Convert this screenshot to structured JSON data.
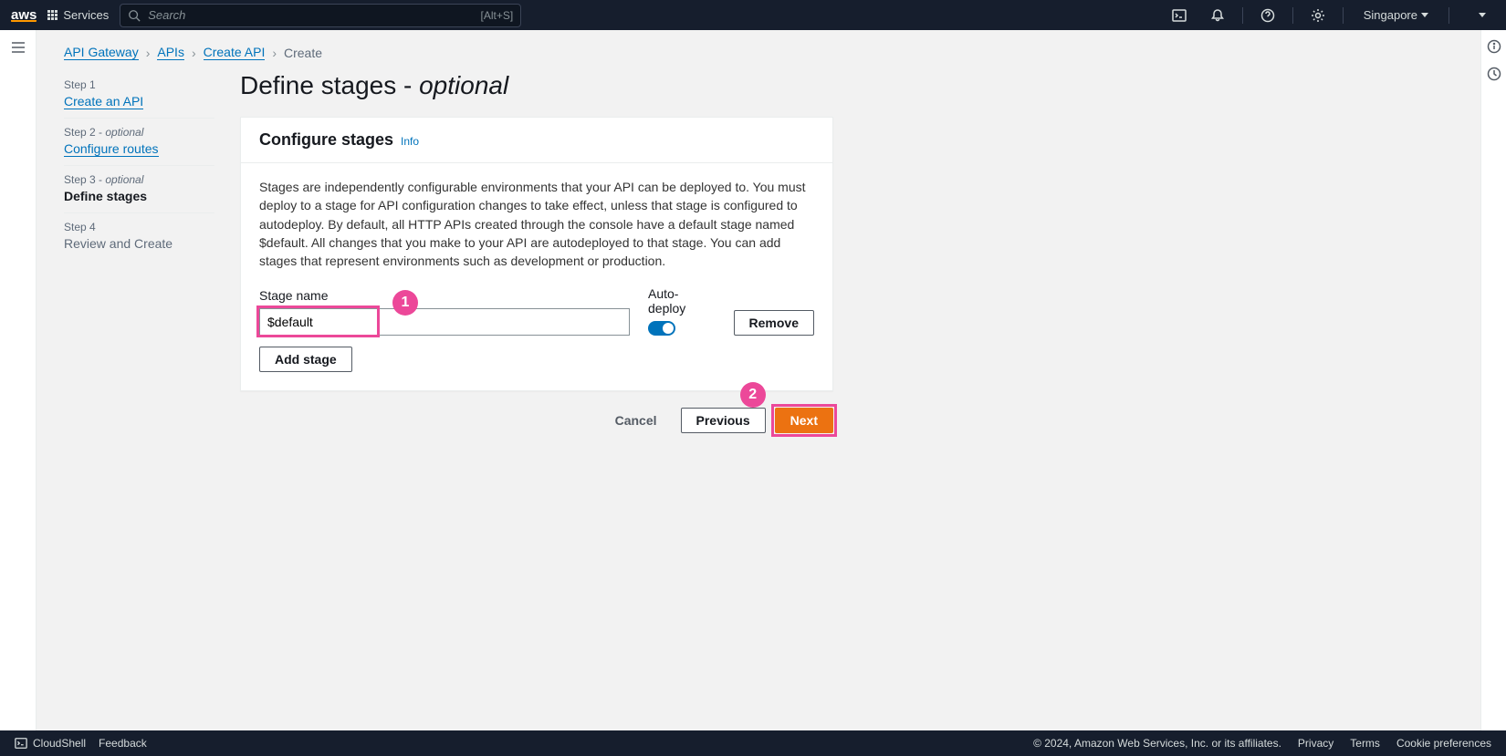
{
  "header": {
    "services": "Services",
    "search_placeholder": "Search",
    "shortcut": "[Alt+S]",
    "region": "Singapore"
  },
  "breadcrumbs": {
    "b1": "API Gateway",
    "b2": "APIs",
    "b3": "Create API",
    "b4": "Create"
  },
  "wizard": {
    "step1_label": "Step 1",
    "step1_link": "Create an API",
    "step2_label": "Step 2 - ",
    "step2_opt": "optional",
    "step2_link": "Configure routes",
    "step3_label": "Step 3 - ",
    "step3_opt": "optional",
    "step3_current": "Define stages",
    "step4_label": "Step 4",
    "step4_future": "Review and Create"
  },
  "page": {
    "title": "Define stages - ",
    "title_opt": "optional"
  },
  "panel": {
    "heading": "Configure stages",
    "info": "Info",
    "desc": "Stages are independently configurable environments that your API can be deployed to. You must deploy to a stage for API configuration changes to take effect, unless that stage is configured to autodeploy. By default, all HTTP APIs created through the console have a default stage named $default. All changes that you make to your API are autodeployed to that stage. You can add stages that represent environments such as development or production.",
    "stage_name_label": "Stage name",
    "stage_name_value": "$default",
    "auto_deploy_label": "Auto-deploy",
    "remove_btn": "Remove",
    "add_stage_btn": "Add stage"
  },
  "actions": {
    "cancel": "Cancel",
    "previous": "Previous",
    "next": "Next"
  },
  "annotations": {
    "one": "1",
    "two": "2"
  },
  "footer": {
    "cloudshell": "CloudShell",
    "feedback": "Feedback",
    "copyright": "© 2024, Amazon Web Services, Inc. or its affiliates.",
    "privacy": "Privacy",
    "terms": "Terms",
    "cookies": "Cookie preferences"
  }
}
